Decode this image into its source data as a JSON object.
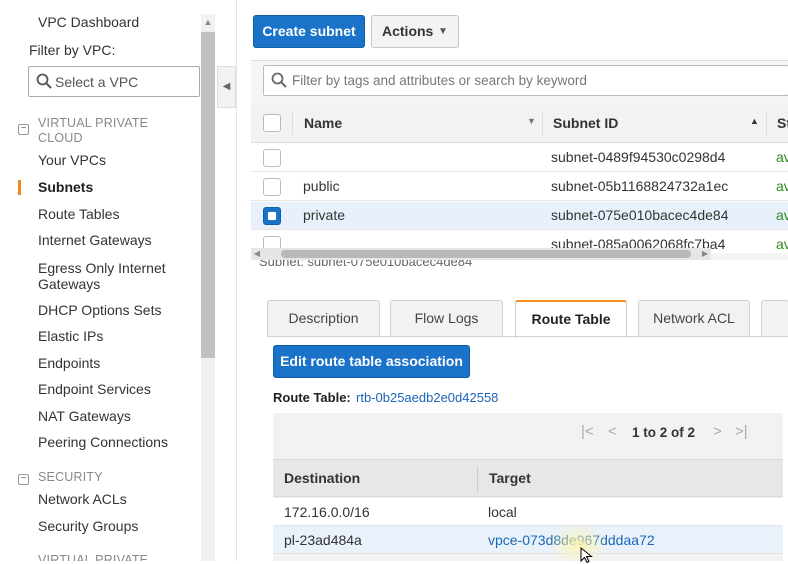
{
  "sidebar": {
    "dashboard": "VPC Dashboard",
    "filter_label": "Filter by VPC:",
    "vpc_select_placeholder": "Select a VPC",
    "section_vpc": "VIRTUAL PRIVATE CLOUD",
    "items_vpc": [
      "Your VPCs",
      "Subnets",
      "Route Tables",
      "Internet Gateways",
      "Egress Only Internet Gateways",
      "DHCP Options Sets",
      "Elastic IPs",
      "Endpoints",
      "Endpoint Services",
      "NAT Gateways",
      "Peering Connections"
    ],
    "active_item": "Subnets",
    "section_security": "SECURITY",
    "items_security": [
      "Network ACLs",
      "Security Groups"
    ],
    "section_bottom": "VIRTUAL PRIVATE"
  },
  "toolbar": {
    "create_label": "Create subnet",
    "actions_label": "Actions"
  },
  "filter": {
    "placeholder": "Filter by tags and attributes or search by keyword"
  },
  "grid": {
    "columns": [
      "Name",
      "Subnet ID",
      "St"
    ],
    "rows": [
      {
        "name": "",
        "subnet_id": "subnet-0489f94530c0298d4",
        "state": "av",
        "checked": false
      },
      {
        "name": "public",
        "subnet_id": "subnet-05b1168824732a1ec",
        "state": "av",
        "checked": false
      },
      {
        "name": "private",
        "subnet_id": "subnet-075e010bacec4de84",
        "state": "av",
        "checked": true
      },
      {
        "name": "",
        "subnet_id": "subnet-085a0062068fc7ba4",
        "state": "av",
        "checked": false
      }
    ],
    "cutoff_line": "Subnet: subnet-075e010bacec4de84"
  },
  "details": {
    "tabs": [
      "Description",
      "Flow Logs",
      "Route Table",
      "Network ACL",
      ""
    ],
    "active_tab": "Route Table",
    "edit_button": "Edit route table association",
    "route_table_label": "Route Table:",
    "route_table_id": "rtb-0b25aedb2e0d42558",
    "pager_text": "1 to 2 of 2",
    "columns": [
      "Destination",
      "Target"
    ],
    "routes": [
      {
        "destination": "172.16.0.0/16",
        "target": "local"
      },
      {
        "destination": "pl-23ad484a",
        "target": "vpce-073d8de967dddaa72"
      }
    ]
  },
  "colors": {
    "primary_button": "#1a73c9",
    "active_accent": "#f08a1c",
    "link": "#1a66b8",
    "state_green": "#2e8b1e"
  }
}
